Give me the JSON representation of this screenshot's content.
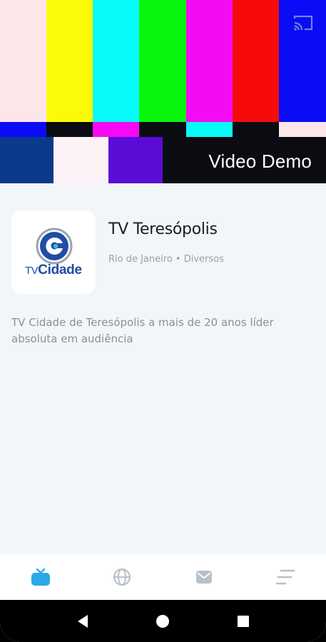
{
  "player": {
    "title": "Video Demo",
    "cast_icon": "cast-icon",
    "test_pattern": {
      "top": [
        "#fde6ea",
        "#fbfb07",
        "#08fbfb",
        "#08f60b",
        "#f40bf4",
        "#f60b0a",
        "#0b0bf6"
      ],
      "middle": [
        "#0b0bf6",
        "#0b0b12",
        "#f40bf4",
        "#0b0b12",
        "#08fbfb",
        "#0b0b12",
        "#fde6ea"
      ],
      "bottom": [
        "#0b3a8a",
        "#fdf3f6",
        "#5a0bd6",
        "#0b0b12",
        "#0b0b12",
        "#0b0b12",
        "#0b0b12"
      ]
    }
  },
  "channel": {
    "logo_text_tv": "TV",
    "logo_text_cidade": "Cidade",
    "name": "TV Teresópolis",
    "meta": "Rio de Janeiro • Diversos",
    "description": "TV Cidade de Teresópolis a mais de 20 anos líder absoluta em audiência"
  },
  "bottom_nav": {
    "items": [
      {
        "icon": "tv-icon",
        "active": true
      },
      {
        "icon": "globe-icon",
        "active": false
      },
      {
        "icon": "mail-icon",
        "active": false
      },
      {
        "icon": "menu-icon",
        "active": false
      }
    ],
    "active_color": "#2aa9e6",
    "inactive_color": "#b8c0c8"
  },
  "system_nav": {
    "items": [
      "back-icon",
      "home-icon",
      "recents-icon"
    ]
  }
}
